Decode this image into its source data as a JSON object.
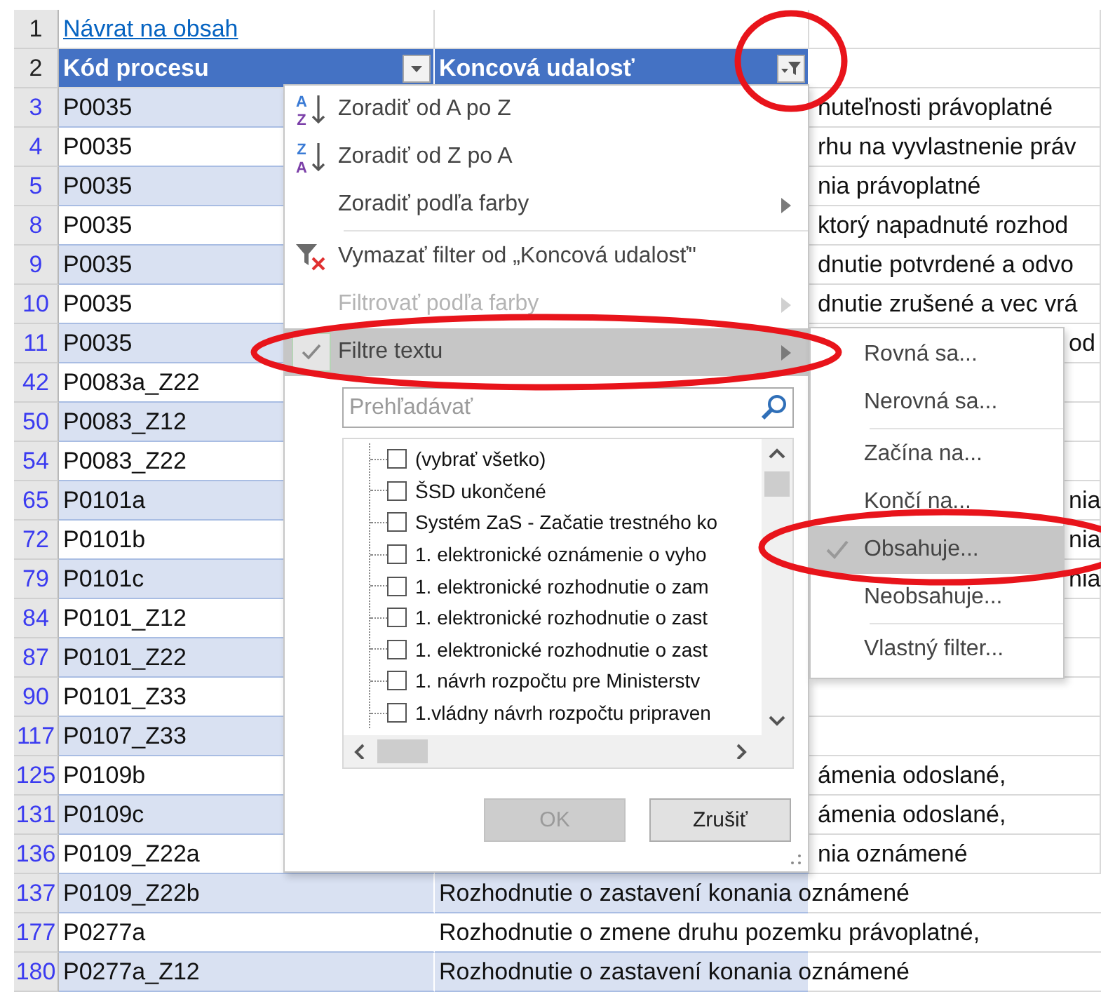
{
  "sheet": {
    "rows": [
      {
        "number": "1",
        "kind": "link",
        "code": "Návrat na obsah"
      },
      {
        "number": "2",
        "kind": "header",
        "code": "Kód procesu",
        "event": "Koncová udalosť",
        "code_filter_active": false,
        "event_filter_active": true,
        "event_filter_circled": true
      },
      {
        "number": "3",
        "kind": "data",
        "code": "P0035",
        "event_tail": "nuteľnosti právoplatné"
      },
      {
        "number": "4",
        "kind": "data",
        "code": "P0035",
        "event_tail": "rhu na vyvlastnenie práv"
      },
      {
        "number": "5",
        "kind": "data",
        "code": "P0035",
        "event_tail": "nia právoplatné"
      },
      {
        "number": "8",
        "kind": "data",
        "code": "P0035",
        "event_tail": "ktorý napadnuté rozhod"
      },
      {
        "number": "9",
        "kind": "data",
        "code": "P0035",
        "event_tail": "dnutie potvrdené a odvo"
      },
      {
        "number": "10",
        "kind": "data",
        "code": "P0035",
        "event_tail": "dnutie zrušené a vec vrá"
      },
      {
        "number": "11",
        "kind": "data",
        "code": "P0035",
        "event_tail": "od"
      },
      {
        "number": "42",
        "kind": "data",
        "code": "P0083a_Z22"
      },
      {
        "number": "50",
        "kind": "data",
        "code": "P0083_Z12"
      },
      {
        "number": "54",
        "kind": "data",
        "code": "P0083_Z22"
      },
      {
        "number": "65",
        "kind": "data",
        "code": "P0101a",
        "event_tail": "nia"
      },
      {
        "number": "72",
        "kind": "data",
        "code": "P0101b",
        "event_tail": "nia"
      },
      {
        "number": "79",
        "kind": "data",
        "code": "P0101c",
        "event_tail": "nia"
      },
      {
        "number": "84",
        "kind": "data",
        "code": "P0101_Z12"
      },
      {
        "number": "87",
        "kind": "data",
        "code": "P0101_Z22"
      },
      {
        "number": "90",
        "kind": "data",
        "code": "P0101_Z33"
      },
      {
        "number": "117",
        "kind": "data",
        "code": "P0107_Z33"
      },
      {
        "number": "125",
        "kind": "data",
        "code": "P0109b",
        "event_tail": "ámenia odoslané,"
      },
      {
        "number": "131",
        "kind": "data",
        "code": "P0109c",
        "event_tail": "ámenia odoslané,"
      },
      {
        "number": "136",
        "kind": "data",
        "code": "P0109_Z22a",
        "event_tail": "nia oznámené"
      },
      {
        "number": "137",
        "kind": "data",
        "code": "P0109_Z22b",
        "event": "Rozhodnutie o zastavení konania oznámené"
      },
      {
        "number": "177",
        "kind": "data",
        "code": "P0277a",
        "event": "Rozhodnutie o zmene druhu pozemku právoplatné,"
      },
      {
        "number": "180",
        "kind": "data",
        "code": "P0277a_Z12",
        "event": "Rozhodnutie o zastavení konania oznámené"
      }
    ]
  },
  "filter_menu": {
    "items": [
      {
        "kind": "sort",
        "icon_letters": [
          "A",
          "Z"
        ],
        "label": "Zoradiť od A po Z",
        "disabled": false,
        "submenu": false,
        "checked": false,
        "selected": false,
        "circled": false
      },
      {
        "kind": "sort",
        "icon_letters": [
          "Z",
          "A"
        ],
        "label": "Zoradiť od Z po A",
        "disabled": false,
        "submenu": false,
        "checked": false,
        "selected": false,
        "circled": false
      },
      {
        "kind": "item",
        "label": "Zoradiť podľa farby",
        "disabled": false,
        "submenu": true,
        "checked": false,
        "selected": false,
        "circled": false
      },
      {
        "kind": "separator"
      },
      {
        "kind": "clear-filter",
        "label": "Vymazať filter od „Koncová udalosť\"",
        "disabled": false,
        "submenu": false,
        "checked": false,
        "selected": false,
        "circled": false
      },
      {
        "kind": "item",
        "label": "Filtrovať podľa farby",
        "disabled": true,
        "submenu": true,
        "checked": false,
        "selected": false,
        "circled": false
      },
      {
        "kind": "item",
        "label": "Filtre textu",
        "disabled": false,
        "submenu": true,
        "checked": true,
        "selected": true,
        "circled": true
      }
    ],
    "search": {
      "placeholder": "Prehľadávať"
    },
    "values": [
      {
        "label": "(vybrať všetko)",
        "checked": false
      },
      {
        "label": "ŠSD ukončené",
        "checked": false
      },
      {
        "label": "Systém ZaS - Začatie trestného ko",
        "checked": false
      },
      {
        "label": "1. elektronické oznámenie o vyho",
        "checked": false
      },
      {
        "label": "1. elektronické rozhodnutie o zam",
        "checked": false
      },
      {
        "label": "1. elektronické rozhodnutie o zast",
        "checked": false
      },
      {
        "label": "1. elektronické rozhodnutie o zast",
        "checked": false
      },
      {
        "label": "1. návrh rozpočtu pre Ministerstv",
        "checked": false
      },
      {
        "label": "1.vládny návrh rozpočtu pripraven",
        "checked": false
      }
    ],
    "buttons": [
      {
        "label": "OK",
        "disabled": true
      },
      {
        "label": "Zrušiť",
        "disabled": false
      }
    ]
  },
  "text_filter_menu": {
    "items": [
      {
        "kind": "item",
        "label": "Rovná sa...",
        "checked": false,
        "selected": false,
        "circled": false
      },
      {
        "kind": "item",
        "label": "Nerovná sa...",
        "checked": false,
        "selected": false,
        "circled": false
      },
      {
        "kind": "separator"
      },
      {
        "kind": "item",
        "label": "Začína na...",
        "checked": false,
        "selected": false,
        "circled": false
      },
      {
        "kind": "item",
        "label": "Končí na...",
        "checked": false,
        "selected": false,
        "circled": false
      },
      {
        "kind": "item",
        "label": "Obsahuje...",
        "checked": true,
        "selected": true,
        "circled": true
      },
      {
        "kind": "item",
        "label": "Neobsahuje...",
        "checked": false,
        "selected": false,
        "circled": false
      },
      {
        "kind": "separator"
      },
      {
        "kind": "item",
        "label": "Vlastný filter...",
        "checked": false,
        "selected": false,
        "circled": false
      }
    ]
  }
}
